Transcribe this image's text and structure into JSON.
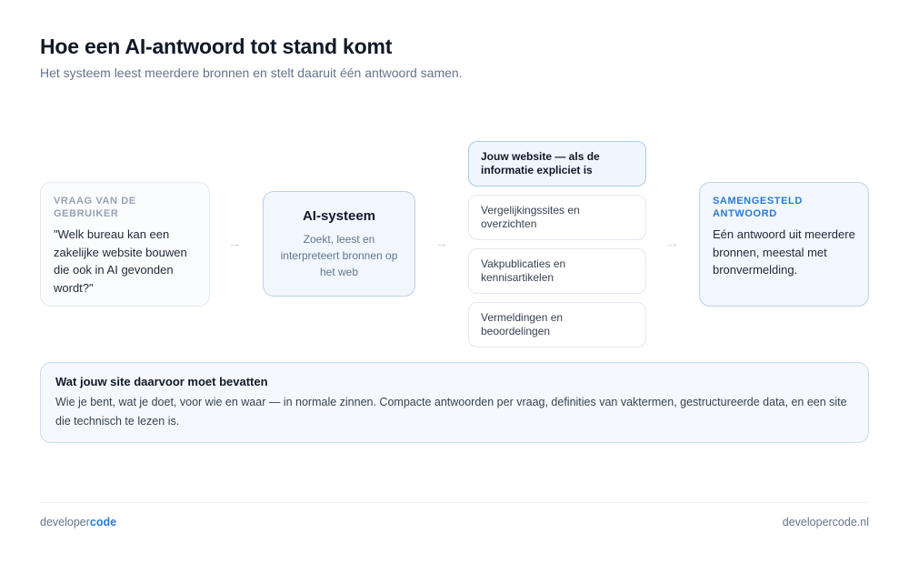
{
  "header": {
    "title": "Hoe een AI-antwoord tot stand komt",
    "subtitle": "Het systeem leest meerdere bronnen en stelt daaruit één antwoord samen."
  },
  "question": {
    "label": "VRAAG VAN DE GEBRUIKER",
    "text": "\"Welk bureau kan een zakelijke website bouwen die ook in AI gevonden wordt?\""
  },
  "arrows": [
    "→",
    "→",
    "→"
  ],
  "ai_system": {
    "title": "AI-systeem",
    "text": "Zoekt, leest en interpreteert bronnen op het web"
  },
  "sources": [
    "Jouw website — als de informatie expliciet is",
    "Vergelijkingssites en overzichten",
    "Vakpublicaties en kennisartikelen",
    "Vermeldingen en beoordelingen"
  ],
  "output": {
    "label": "SAMENGESTELD ANTWOORD",
    "text": "Eén antwoord uit meerdere bronnen, meestal met bronvermelding."
  },
  "requirements": {
    "title": "Wat jouw site daarvoor moet bevatten",
    "text": "Wie je bent, wat je doet, voor wie en waar — in normale zinnen. Compacte antwoorden per vraag, definities van vaktermen, gestructureerde data, en een site die technisch te lezen is."
  },
  "footer": {
    "brand_prefix": "developer",
    "brand_suffix": "code",
    "site": "developercode.nl"
  },
  "colors": {
    "accent": "#2b7bd0",
    "highlight_bg": "#f1f7fd",
    "highlight_border": "#b8d3ea"
  }
}
